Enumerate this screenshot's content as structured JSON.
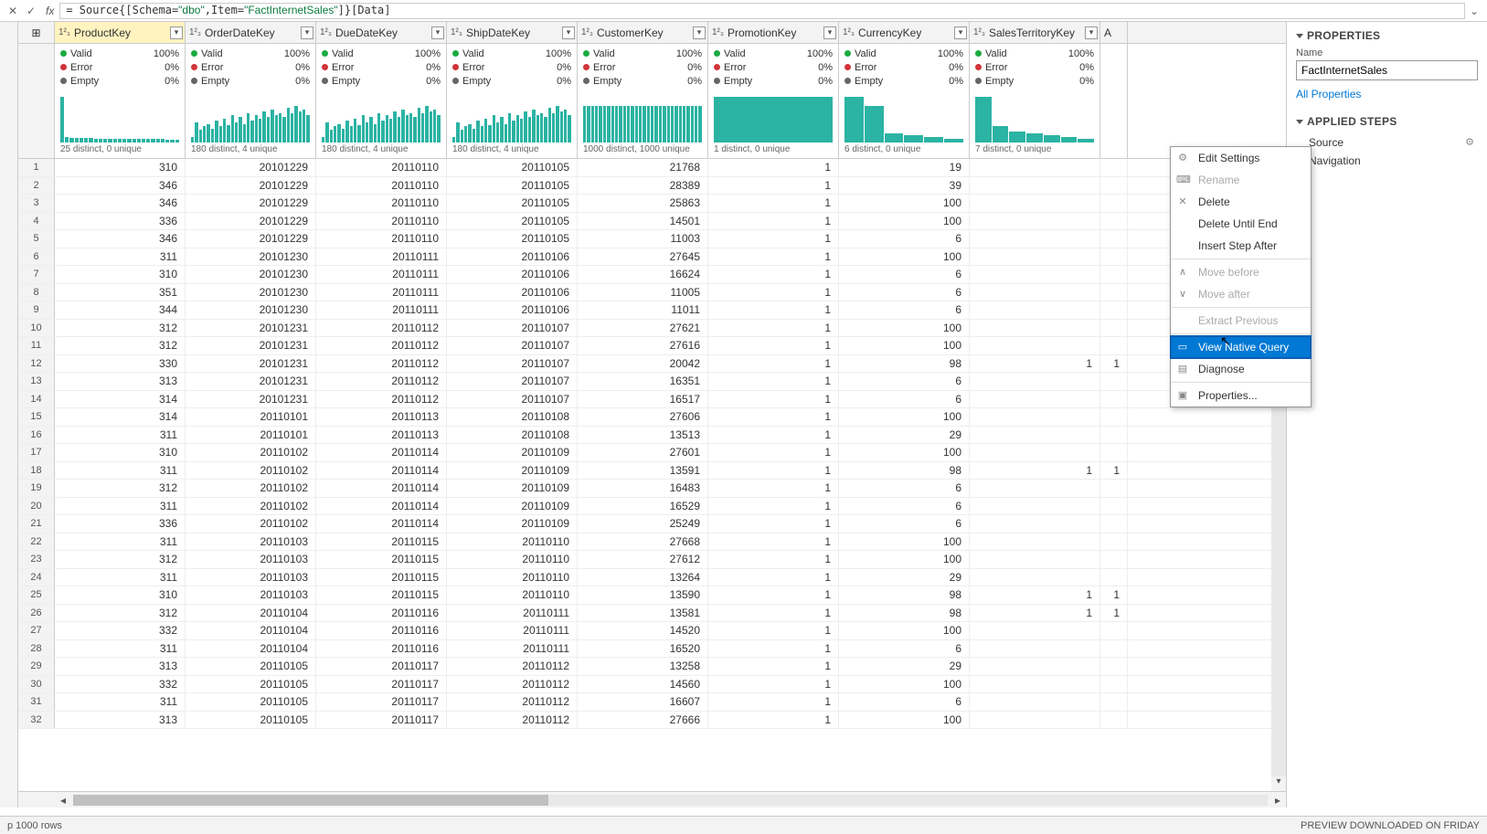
{
  "formula": "= Source{[Schema=\"dbo\",Item=\"FactInternetSales\"]}[Data]",
  "columns": [
    {
      "name": "ProductKey",
      "distinct": "25 distinct, 0 unique",
      "bars": [
        50,
        6,
        5,
        5,
        5,
        5,
        5,
        4,
        4,
        4,
        4,
        4,
        4,
        4,
        4,
        4,
        4,
        4,
        4,
        4,
        4,
        4,
        3,
        3,
        3
      ],
      "selected": true
    },
    {
      "name": "OrderDateKey",
      "distinct": "180 distinct, 4 unique",
      "bars": [
        6,
        22,
        14,
        18,
        20,
        15,
        24,
        18,
        26,
        19,
        30,
        22,
        28,
        20,
        32,
        24,
        30,
        26,
        34,
        28,
        36,
        30,
        32,
        28,
        38,
        32,
        40,
        34,
        36,
        30
      ],
      "selected": false
    },
    {
      "name": "DueDateKey",
      "distinct": "180 distinct, 4 unique",
      "bars": [
        6,
        22,
        14,
        18,
        20,
        15,
        24,
        18,
        26,
        19,
        30,
        22,
        28,
        20,
        32,
        24,
        30,
        26,
        34,
        28,
        36,
        30,
        32,
        28,
        38,
        32,
        40,
        34,
        36,
        30
      ],
      "selected": false
    },
    {
      "name": "ShipDateKey",
      "distinct": "180 distinct, 4 unique",
      "bars": [
        6,
        22,
        14,
        18,
        20,
        15,
        24,
        18,
        26,
        19,
        30,
        22,
        28,
        20,
        32,
        24,
        30,
        26,
        34,
        28,
        36,
        30,
        32,
        28,
        38,
        32,
        40,
        34,
        36,
        30
      ],
      "selected": false
    },
    {
      "name": "CustomerKey",
      "distinct": "1000 distinct, 1000 unique",
      "bars": [
        40,
        40,
        40,
        40,
        40,
        40,
        40,
        40,
        40,
        40,
        40,
        40,
        40,
        40,
        40,
        40,
        40,
        40,
        40,
        40,
        40,
        40,
        40,
        40,
        40,
        40,
        40,
        40,
        40,
        40
      ],
      "selected": false
    },
    {
      "name": "PromotionKey",
      "distinct": "1 distinct, 0 unique",
      "bars": [
        50
      ],
      "selected": false
    },
    {
      "name": "CurrencyKey",
      "distinct": "6 distinct, 0 unique",
      "bars": [
        50,
        40,
        10,
        8,
        6,
        4
      ],
      "selected": false
    },
    {
      "name": "SalesTerritoryKey",
      "distinct": "7 distinct, 0 unique",
      "bars": [
        50,
        18,
        12,
        10,
        8,
        6,
        4
      ],
      "selected": false
    }
  ],
  "stat_labels": {
    "valid": "Valid",
    "error": "Error",
    "empty": "Empty",
    "valid_pct": "100%",
    "zero_pct": "0%"
  },
  "last_col_label": "A",
  "rows": [
    [
      310,
      20101229,
      20110110,
      20110105,
      21768,
      1,
      19,
      ""
    ],
    [
      346,
      20101229,
      20110110,
      20110105,
      28389,
      1,
      39,
      ""
    ],
    [
      346,
      20101229,
      20110110,
      20110105,
      25863,
      1,
      100,
      ""
    ],
    [
      336,
      20101229,
      20110110,
      20110105,
      14501,
      1,
      100,
      ""
    ],
    [
      346,
      20101229,
      20110110,
      20110105,
      11003,
      1,
      6,
      ""
    ],
    [
      311,
      20101230,
      20110111,
      20110106,
      27645,
      1,
      100,
      ""
    ],
    [
      310,
      20101230,
      20110111,
      20110106,
      16624,
      1,
      6,
      ""
    ],
    [
      351,
      20101230,
      20110111,
      20110106,
      11005,
      1,
      6,
      ""
    ],
    [
      344,
      20101230,
      20110111,
      20110106,
      11011,
      1,
      6,
      ""
    ],
    [
      312,
      20101231,
      20110112,
      20110107,
      27621,
      1,
      100,
      ""
    ],
    [
      312,
      20101231,
      20110112,
      20110107,
      27616,
      1,
      100,
      ""
    ],
    [
      330,
      20101231,
      20110112,
      20110107,
      20042,
      1,
      98,
      "1"
    ],
    [
      313,
      20101231,
      20110112,
      20110107,
      16351,
      1,
      6,
      ""
    ],
    [
      314,
      20101231,
      20110112,
      20110107,
      16517,
      1,
      6,
      ""
    ],
    [
      314,
      20110101,
      20110113,
      20110108,
      27606,
      1,
      100,
      ""
    ],
    [
      311,
      20110101,
      20110113,
      20110108,
      13513,
      1,
      29,
      ""
    ],
    [
      310,
      20110102,
      20110114,
      20110109,
      27601,
      1,
      100,
      ""
    ],
    [
      311,
      20110102,
      20110114,
      20110109,
      13591,
      1,
      98,
      "1"
    ],
    [
      312,
      20110102,
      20110114,
      20110109,
      16483,
      1,
      6,
      ""
    ],
    [
      311,
      20110102,
      20110114,
      20110109,
      16529,
      1,
      6,
      ""
    ],
    [
      336,
      20110102,
      20110114,
      20110109,
      25249,
      1,
      6,
      ""
    ],
    [
      311,
      20110103,
      20110115,
      20110110,
      27668,
      1,
      100,
      ""
    ],
    [
      312,
      20110103,
      20110115,
      20110110,
      27612,
      1,
      100,
      ""
    ],
    [
      311,
      20110103,
      20110115,
      20110110,
      13264,
      1,
      29,
      ""
    ],
    [
      310,
      20110103,
      20110115,
      20110110,
      13590,
      1,
      98,
      "1"
    ],
    [
      312,
      20110104,
      20110116,
      20110111,
      13581,
      1,
      98,
      "1"
    ],
    [
      332,
      20110104,
      20110116,
      20110111,
      14520,
      1,
      100,
      ""
    ],
    [
      311,
      20110104,
      20110116,
      20110111,
      16520,
      1,
      6,
      ""
    ],
    [
      313,
      20110105,
      20110117,
      20110112,
      13258,
      1,
      29,
      ""
    ],
    [
      332,
      20110105,
      20110117,
      20110112,
      14560,
      1,
      100,
      ""
    ],
    [
      311,
      20110105,
      20110117,
      20110112,
      16607,
      1,
      6,
      ""
    ],
    [
      313,
      20110105,
      20110117,
      20110112,
      27666,
      1,
      100,
      ""
    ]
  ],
  "properties": {
    "title": "PROPERTIES",
    "name_label": "Name",
    "name_value": "FactInternetSales",
    "all_props": "All Properties"
  },
  "applied_steps": {
    "title": "APPLIED STEPS",
    "steps": [
      "Source",
      "Navigation"
    ]
  },
  "context_menu": [
    {
      "label": "Edit Settings",
      "icon": "⚙",
      "disabled": false
    },
    {
      "label": "Rename",
      "icon": "⌨",
      "disabled": true
    },
    {
      "label": "Delete",
      "icon": "✕",
      "disabled": false
    },
    {
      "label": "Delete Until End",
      "icon": "",
      "disabled": false
    },
    {
      "label": "Insert Step After",
      "icon": "",
      "disabled": false,
      "sep_after": true
    },
    {
      "label": "Move before",
      "icon": "∧",
      "disabled": true
    },
    {
      "label": "Move after",
      "icon": "∨",
      "disabled": true,
      "sep_after": true
    },
    {
      "label": "Extract Previous",
      "icon": "",
      "disabled": true,
      "sep_after": true
    },
    {
      "label": "View Native Query",
      "icon": "▭",
      "disabled": false,
      "highlight": true
    },
    {
      "label": "Diagnose",
      "icon": "▤",
      "disabled": false,
      "sep_after": true
    },
    {
      "label": "Properties...",
      "icon": "▣",
      "disabled": false
    }
  ],
  "status": {
    "left": "p 1000 rows",
    "right": "PREVIEW DOWNLOADED ON FRIDAY"
  },
  "table_icon": "⊞"
}
